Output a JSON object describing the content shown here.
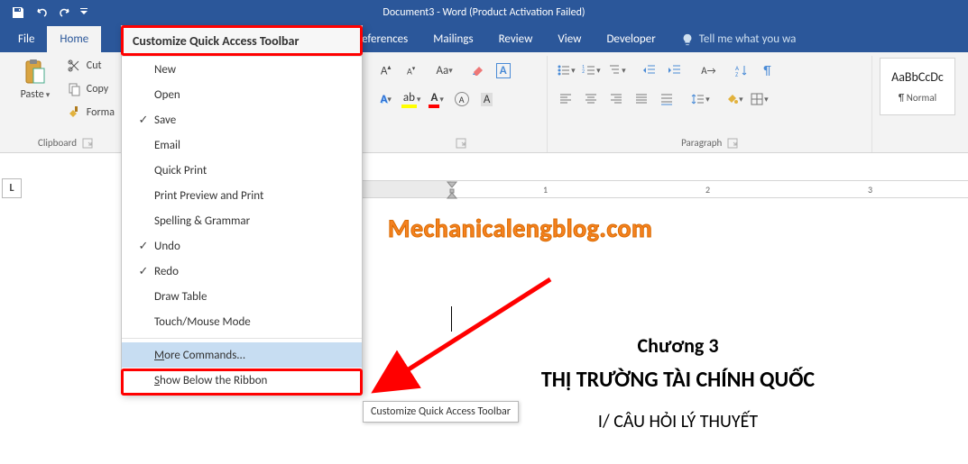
{
  "title": "Document3 - Word (Product Activation Failed)",
  "tabs": {
    "file": "File",
    "home": "Home",
    "references": "References",
    "mailings": "Mailings",
    "review": "Review",
    "view": "View",
    "developer": "Developer",
    "tellme": "Tell me what you wa"
  },
  "clipboard": {
    "paste": "Paste",
    "cut": "Cut",
    "copy": "Copy",
    "format": "Forma",
    "group": "Clipboard"
  },
  "paragraph_group": "Paragraph",
  "style": {
    "sample": "AaBbCcDc",
    "name": "¶ Normal"
  },
  "menu": {
    "title": "Customize Quick Access Toolbar",
    "items": [
      {
        "label": "New",
        "checked": false
      },
      {
        "label": "Open",
        "checked": false
      },
      {
        "label": "Save",
        "checked": true
      },
      {
        "label": "Email",
        "checked": false
      },
      {
        "label": "Quick Print",
        "checked": false
      },
      {
        "label": "Print Preview and Print",
        "checked": false
      },
      {
        "label": "Spelling & Grammar",
        "checked": false
      },
      {
        "label": "Undo",
        "checked": true
      },
      {
        "label": "Redo",
        "checked": true
      },
      {
        "label": "Draw Table",
        "checked": false
      },
      {
        "label": "Touch/Mouse Mode",
        "checked": false
      }
    ],
    "more": "More Commands...",
    "below": "Show Below the Ribbon"
  },
  "tooltip": "Customize Quick Access Toolbar",
  "watermark": "Mechanicalengblog.com",
  "doc": {
    "h3": "Chương 3",
    "h2": "THỊ TRƯỜNG TÀI CHÍNH QUỐC",
    "p": "I/ CÂU HỎI LÝ THUYẾT"
  },
  "ruler_numbers": [
    "1",
    "2",
    "3"
  ],
  "Lmark": "L"
}
